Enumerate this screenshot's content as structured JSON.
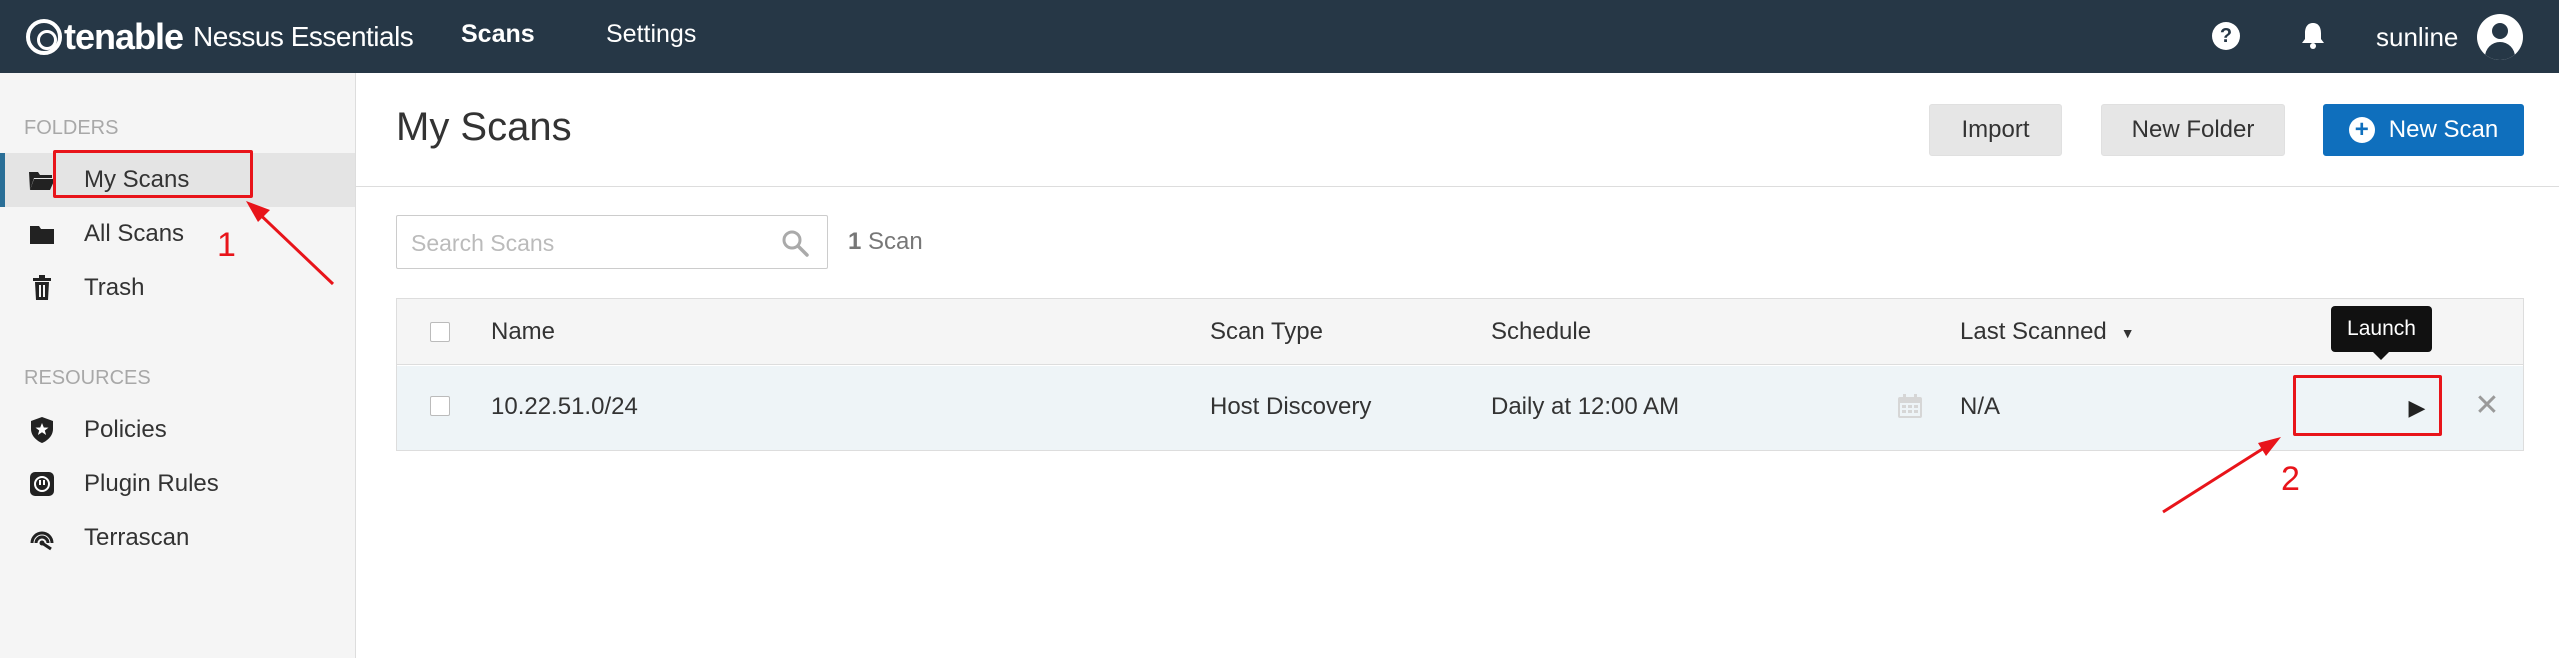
{
  "app": {
    "brand": "tenable",
    "product": "Nessus Essentials",
    "nav": {
      "scans": "Scans",
      "settings": "Settings"
    },
    "user": {
      "name": "sunline"
    },
    "icons": {
      "help": "help-icon",
      "notifications": "bell-icon",
      "avatar": "user-avatar-icon"
    },
    "colors": {
      "topbar": "#263746",
      "accent": "#0f6fbd",
      "annotation": "#e8141a"
    }
  },
  "sidebar": {
    "folders_label": "FOLDERS",
    "folders": [
      {
        "label": "My Scans",
        "icon": "folder-open-icon",
        "active": true
      },
      {
        "label": "All Scans",
        "icon": "folder-icon",
        "active": false
      },
      {
        "label": "Trash",
        "icon": "trash-icon",
        "active": false
      }
    ],
    "resources_label": "RESOURCES",
    "resources": [
      {
        "label": "Policies",
        "icon": "policies-shield-icon"
      },
      {
        "label": "Plugin Rules",
        "icon": "plugin-rules-icon"
      },
      {
        "label": "Terrascan",
        "icon": "terrascan-icon"
      }
    ]
  },
  "main": {
    "title": "My Scans",
    "buttons": {
      "import": "Import",
      "new_folder": "New Folder",
      "new_scan": "New Scan"
    },
    "search": {
      "placeholder": "Search Scans",
      "value": ""
    },
    "count": {
      "number": "1",
      "label": "Scan"
    },
    "table": {
      "headers": {
        "name": "Name",
        "scan_type": "Scan Type",
        "schedule": "Schedule",
        "last_scanned": "Last Scanned"
      },
      "rows": [
        {
          "name": "10.22.51.0/24",
          "scan_type": "Host Discovery",
          "schedule": "Daily at 12:00 AM",
          "last_scanned": "N/A",
          "launch_symbol": "▶",
          "remove_symbol": "✕"
        }
      ]
    },
    "tooltip": "Launch"
  },
  "annotations": {
    "step1": "1",
    "step2": "2"
  }
}
